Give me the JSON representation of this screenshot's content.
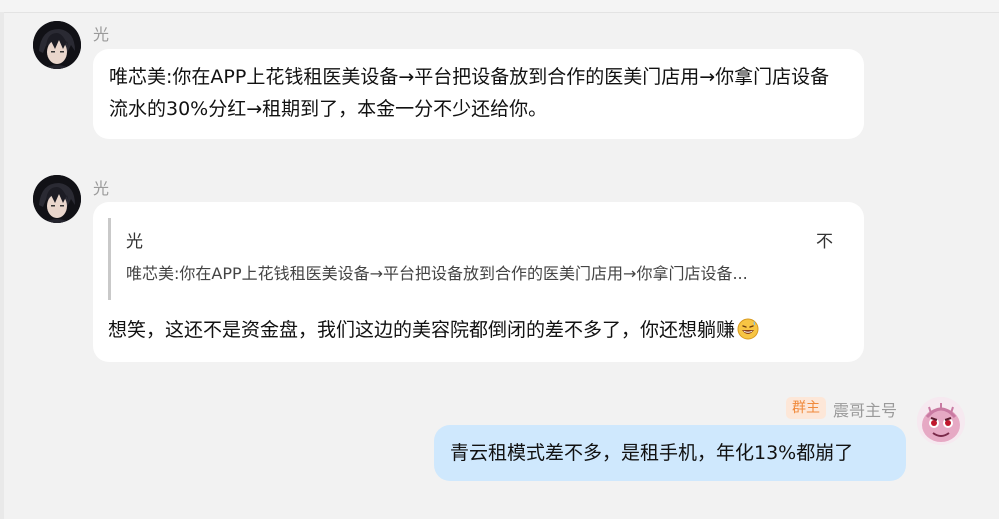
{
  "messages": [
    {
      "sender": "光",
      "text": "唯芯美:你在APP上花钱租医美设备→平台把设备放到合作的医美门店用→你拿门店设备流水的30%分红→租期到了，本金一分不少还给你。",
      "avatar_icon": "dark-hair-avatar-icon"
    },
    {
      "sender": "光",
      "avatar_icon": "dark-hair-avatar-icon",
      "quote": {
        "author": "光",
        "collapse_label": "不",
        "text": "唯芯美:你在APP上花钱租医美设备→平台把设备放到合作的医美门店用→你拿门店设备..."
      },
      "text": "想笑，这还不是资金盘，我们这边的美容院都倒闭的差不多了，你还想躺赚",
      "emoji": "grinning-sweat-emoji-icon"
    },
    {
      "sender": "震哥主号",
      "badge": "群主",
      "avatar_icon": "pink-creature-avatar-icon",
      "text": "青云租模式差不多，是租手机，年化13%都崩了"
    }
  ],
  "colors": {
    "background": "#f2f2f2",
    "incoming_bubble": "#ffffff",
    "outgoing_bubble": "#cfe8fd",
    "badge_bg": "#fde7d8",
    "badge_text": "#f08a3c",
    "sender_name": "#9a9a9a"
  }
}
